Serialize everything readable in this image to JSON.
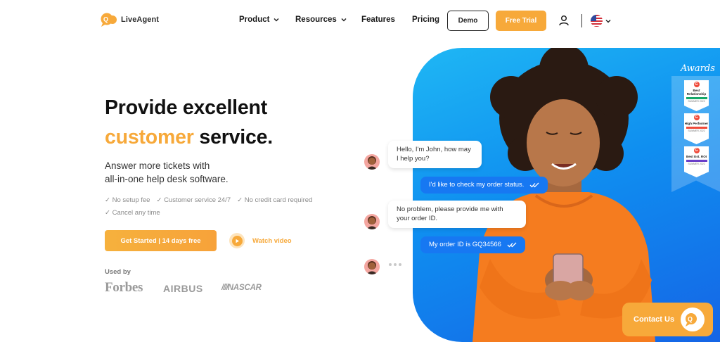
{
  "header": {
    "logo_text": "LiveAgent",
    "nav": [
      {
        "label": "Product",
        "dropdown": true
      },
      {
        "label": "Resources",
        "dropdown": true
      },
      {
        "label": "Features",
        "dropdown": false
      },
      {
        "label": "Pricing",
        "dropdown": false
      }
    ],
    "demo_label": "Demo",
    "trial_label": "Free Trial",
    "language_flag": "us-flag-icon"
  },
  "hero": {
    "headline_line1": "Provide excellent",
    "headline_accent": "customer",
    "headline_rest": " service.",
    "subhead_line1": "Answer more tickets with",
    "subhead_line2": "all-in-one help desk software.",
    "checks": [
      "✓ No setup fee",
      "✓ Customer service 24/7",
      "✓ No credit card required",
      "✓ Cancel any time"
    ],
    "cta_label": "Get Started | 14 days free",
    "watch_label": "Watch video",
    "used_by_label": "Used by",
    "brands": [
      "Forbes",
      "AIRBUS",
      "NASCAR"
    ]
  },
  "chat": {
    "agent_msg1": "Hello, I'm John, how may I help you?",
    "customer_msg1": "I'd like to check my order status.",
    "agent_msg2": "No problem, please provide me with your order ID.",
    "customer_msg2": "My order ID is GQ34566"
  },
  "awards": {
    "label": "Awards",
    "badges": [
      {
        "title": "Best Relationship",
        "season": "SUMMER 2022",
        "strip_color": "#16a86a"
      },
      {
        "title": "High Performer",
        "season": "SUMMER 2022",
        "strip_color": "#ef4a3a"
      },
      {
        "title": "Best Est. ROI",
        "season": "SUMMER 2022",
        "strip_color": "#6a3fc8"
      }
    ]
  },
  "contact": {
    "label": "Contact Us"
  },
  "colors": {
    "accent": "#f7a93a",
    "panel_blue": "#1778f2"
  }
}
